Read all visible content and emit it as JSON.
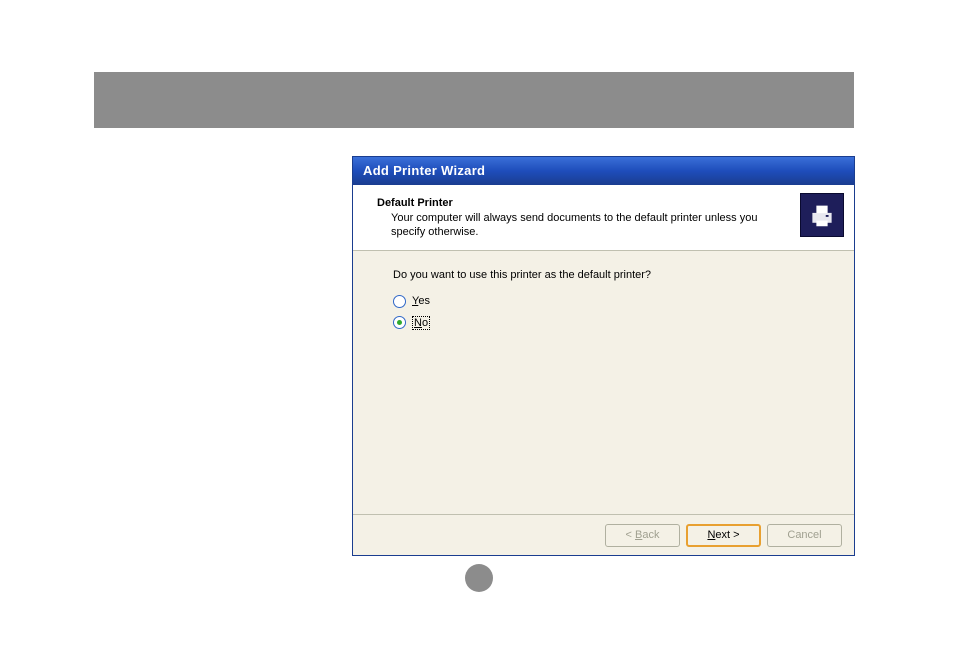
{
  "wizard": {
    "title": "Add Printer Wizard",
    "header": {
      "title": "Default Printer",
      "subtitle": "Your computer will always send documents to the default printer unless you specify otherwise."
    },
    "content": {
      "question": "Do you want to use this printer as the default printer?",
      "options": {
        "yes": {
          "prefix": "Y",
          "rest": "es",
          "selected": false
        },
        "no": {
          "prefix": "N",
          "rest": "o",
          "selected": true
        }
      }
    },
    "buttons": {
      "back": {
        "prefix": "< ",
        "u": "B",
        "rest": "ack"
      },
      "next": {
        "u": "N",
        "rest": "ext >"
      },
      "cancel": "Cancel"
    }
  }
}
